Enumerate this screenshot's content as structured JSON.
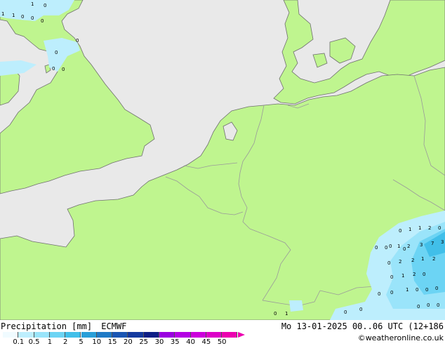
{
  "title": "Precipitation [mm]",
  "model": "ECMWF",
  "datetime": "Mo 13-01-2025 00..06 UTC (12+186",
  "credit": "©weatheronline.co.uk",
  "colors": {
    "sea": "#e9e9e9",
    "land": "#bff58f",
    "border": "#9a9a9a",
    "coast": "#707070"
  },
  "legend": {
    "ticks": [
      "0.1",
      "0.5",
      "1",
      "2",
      "5",
      "10",
      "15",
      "20",
      "25",
      "30",
      "35",
      "40",
      "45",
      "50"
    ],
    "colors": [
      "#f0fbff",
      "#bdeefd",
      "#9ae4fa",
      "#6cd4f4",
      "#41bfe9",
      "#2a9fd8",
      "#1f7ac6",
      "#1a56b3",
      "#143a9f",
      "#0e1f86",
      "#9a00e0",
      "#b400e4",
      "#cc00dc",
      "#dc00c8",
      "#ec00b0"
    ]
  },
  "map_labels": [
    "1",
    "1",
    "0",
    "0",
    "1",
    "0",
    "0",
    "0",
    "0",
    "0",
    "0",
    "0",
    "0",
    "0",
    "1",
    "1",
    "2",
    "0",
    "0",
    "1",
    "2",
    "3",
    "7",
    "3",
    "0",
    "2",
    "2",
    "1",
    "2",
    "1",
    "2",
    "0",
    "0",
    "1",
    "0",
    "0",
    "0",
    "0",
    "0",
    "0",
    "0",
    "0",
    "0",
    "1",
    "0",
    "0",
    "0"
  ]
}
